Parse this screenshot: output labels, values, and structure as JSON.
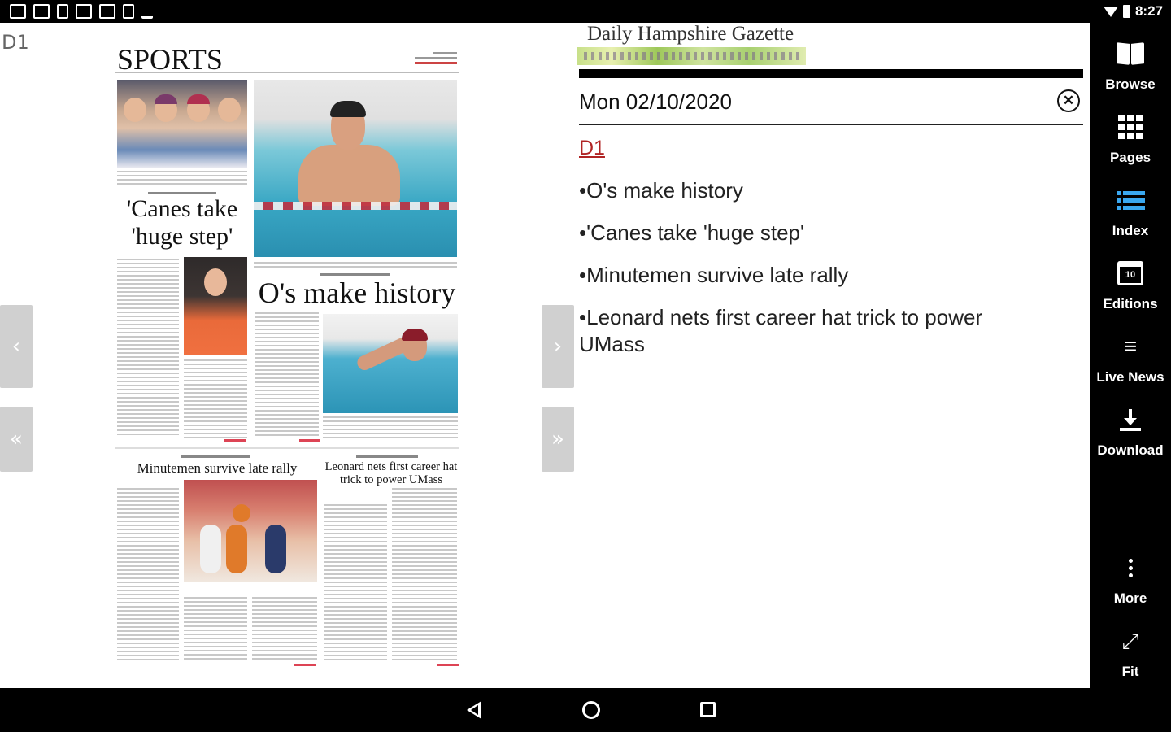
{
  "status_bar": {
    "time": "8:27",
    "icons": [
      "notification-icon",
      "gallery-icon",
      "app-icon",
      "calendar-icon",
      "calendar-icon",
      "download-icon",
      "check-icon",
      "wifi-icon",
      "battery-icon"
    ]
  },
  "page": {
    "label": "D1"
  },
  "newspaper": {
    "section_title": "SPORTS",
    "headlines": {
      "canes": "'Canes take 'huge step'",
      "os": "O's make history",
      "minutemen": "Minutemen survive late rally",
      "leonard": "Leonard nets first career hat trick to power UMass"
    }
  },
  "navigation": {
    "prev": "‹",
    "first": "«",
    "next": "›",
    "last": "»"
  },
  "index_panel": {
    "masthead": "Daily Hampshire Gazette",
    "date": "Mon 02/10/2020",
    "close": "✕",
    "section": "D1",
    "articles": [
      "•O's make history",
      "•'Canes take 'huge step'",
      "•Minutemen survive late rally",
      "•Leonard nets first career hat trick to power UMass"
    ]
  },
  "sidebar": {
    "browse": "Browse",
    "pages": "Pages",
    "index": "Index",
    "editions": "Editions",
    "editions_day": "10",
    "live_news": "Live News",
    "download": "Download",
    "more": "More",
    "fit": "Fit",
    "accent": "#3aa8f0"
  },
  "colors": {
    "section_link": "#b02424",
    "nav_button": "#d0d0d0"
  }
}
